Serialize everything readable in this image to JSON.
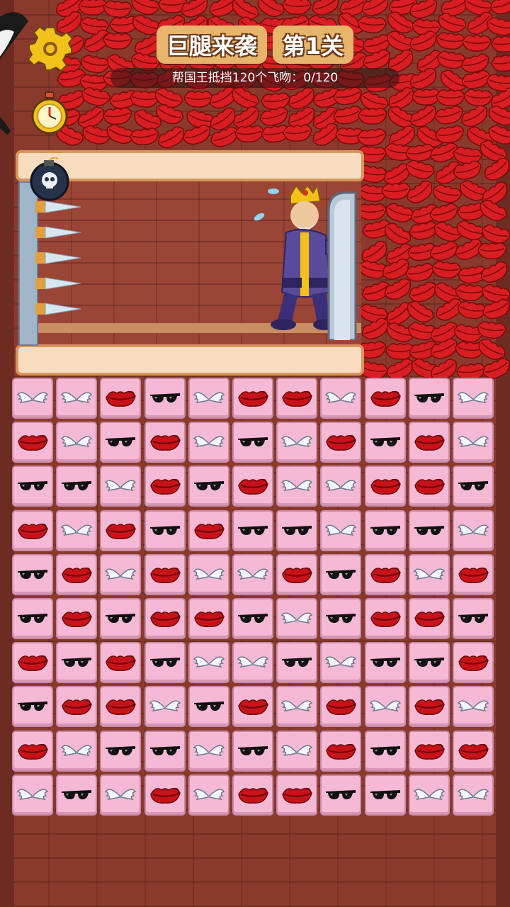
{
  "header": {
    "title": "巨腿来袭",
    "level": "第1关",
    "objective": "帮国王抵挡120个飞吻：0/120"
  },
  "hud": {
    "settings_icon": "gear-icon",
    "timer_icon": "stopwatch-icon"
  },
  "colors": {
    "tile": "#f5b9d6",
    "kiss": "#d81e23",
    "title_bg": "#e6b56b"
  },
  "board": {
    "rows": 10,
    "cols": 11,
    "tiles": [
      [
        "wings",
        "wings",
        "lips",
        "glasses",
        "wings",
        "lips",
        "lips",
        "wings",
        "lips",
        "glasses",
        "wings"
      ],
      [
        "lips",
        "wings",
        "glasses",
        "lips",
        "wings",
        "glasses",
        "wings",
        "lips",
        "glasses",
        "lips",
        "wings"
      ],
      [
        "glasses",
        "glasses",
        "wings",
        "lips",
        "glasses",
        "lips",
        "wings",
        "wings",
        "lips",
        "lips",
        "glasses"
      ],
      [
        "lips",
        "wings",
        "lips",
        "glasses",
        "lips",
        "glasses",
        "glasses",
        "wings",
        "glasses",
        "glasses",
        "wings"
      ],
      [
        "glasses",
        "lips",
        "wings",
        "lips",
        "wings",
        "wings",
        "lips",
        "glasses",
        "lips",
        "wings",
        "lips"
      ],
      [
        "glasses",
        "lips",
        "glasses",
        "lips",
        "lips",
        "glasses",
        "wings",
        "glasses",
        "lips",
        "lips",
        "glasses"
      ],
      [
        "lips",
        "glasses",
        "lips",
        "glasses",
        "wings",
        "wings",
        "glasses",
        "wings",
        "glasses",
        "glasses",
        "lips"
      ],
      [
        "glasses",
        "lips",
        "lips",
        "wings",
        "glasses",
        "lips",
        "wings",
        "lips",
        "wings",
        "lips",
        "wings"
      ],
      [
        "lips",
        "wings",
        "glasses",
        "glasses",
        "wings",
        "glasses",
        "wings",
        "lips",
        "glasses",
        "lips",
        "lips"
      ],
      [
        "wings",
        "glasses",
        "wings",
        "lips",
        "wings",
        "lips",
        "lips",
        "glasses",
        "glasses",
        "wings",
        "wings"
      ]
    ]
  }
}
